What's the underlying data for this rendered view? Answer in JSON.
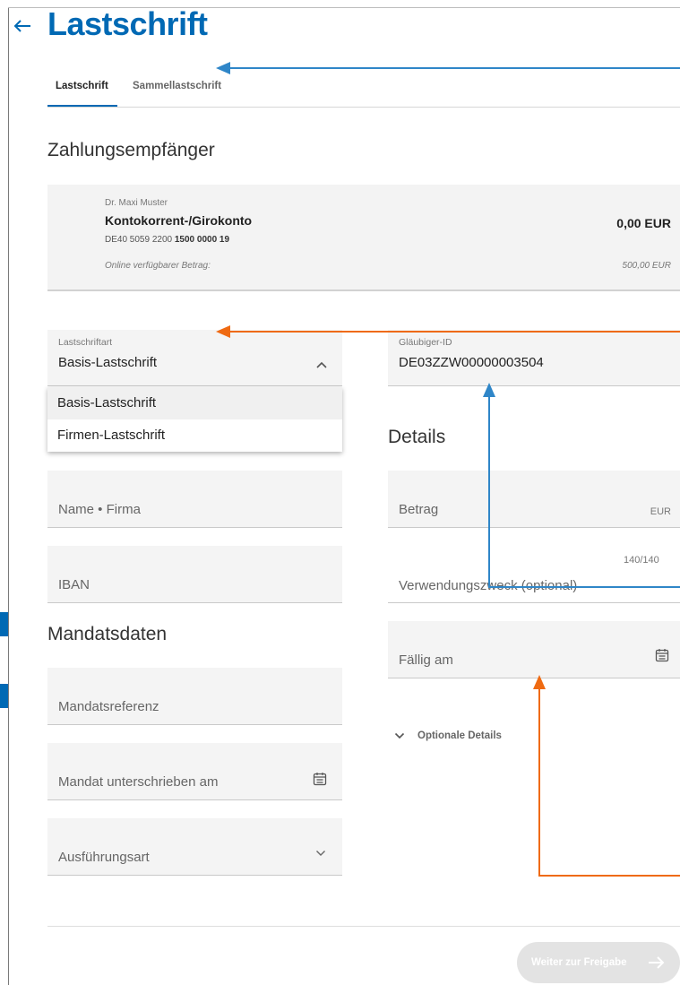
{
  "page": {
    "title": "Lastschrift"
  },
  "tabs": [
    {
      "label": "Lastschrift",
      "active": true
    },
    {
      "label": "Sammellastschrift",
      "active": false
    }
  ],
  "payee_section": {
    "heading": "Zahlungsempfänger"
  },
  "account": {
    "owner": "Dr. Maxi Muster",
    "name": "Kontokorrent-/Girokonto",
    "iban_prefix": "DE40 5059 2200",
    "iban_suffix": "1500 0000 19",
    "amount": "0,00 EUR",
    "available_label": "Online verfügbarer Betrag:",
    "available_value": "500,00 EUR"
  },
  "form": {
    "debit_type": {
      "label": "Lastschriftart",
      "value": "Basis-Lastschrift",
      "options": [
        "Basis-Lastschrift",
        "Firmen-Lastschrift"
      ]
    },
    "creditor_id": {
      "label": "Gläubiger-ID",
      "value": "DE03ZZW00000003504"
    },
    "name": {
      "placeholder": "Name • Firma"
    },
    "iban": {
      "placeholder": "IBAN"
    },
    "details_heading": "Details",
    "amount": {
      "placeholder": "Betrag",
      "currency": "EUR"
    },
    "purpose": {
      "placeholder": "Verwendungszweck (optional)",
      "counter": "140/140"
    },
    "due_date": {
      "placeholder": "Fällig am"
    },
    "optional_details": "Optionale Details",
    "mandate_heading": "Mandatsdaten",
    "mandate_reference": {
      "placeholder": "Mandatsreferenz"
    },
    "mandate_signed": {
      "placeholder": "Mandat unterschrieben am"
    },
    "execution_type": {
      "placeholder": "Ausführungsart"
    }
  },
  "actions": {
    "next_label": "Weiter zur Freigabe"
  },
  "colors": {
    "brand": "#0069b4",
    "annotation_blue": "#2f86c8",
    "annotation_orange": "#ef6a12"
  }
}
